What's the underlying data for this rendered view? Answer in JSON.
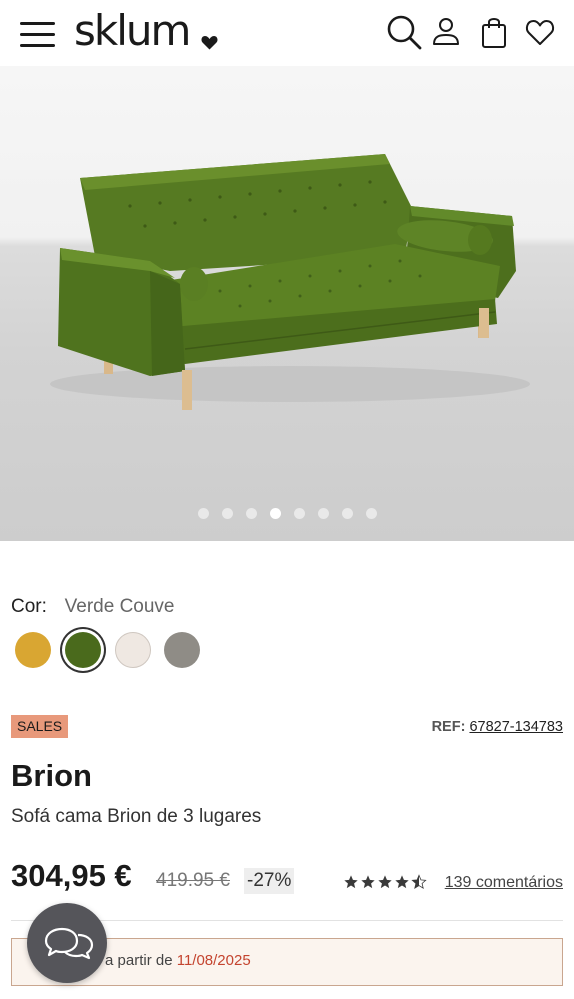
{
  "header": {
    "logo_text": "sklum",
    "menu_icon": "hamburger-icon",
    "icons": [
      "search-icon",
      "user-icon",
      "bag-icon",
      "heart-icon"
    ]
  },
  "gallery": {
    "slide_count": 8,
    "active_index": 3
  },
  "color": {
    "label": "Cor:",
    "selected": "Verde Couve",
    "options": [
      {
        "name": "mustard",
        "hex": "#d9a632"
      },
      {
        "name": "green",
        "hex": "#4a6a1c"
      },
      {
        "name": "cream",
        "hex": "#efe8e2"
      },
      {
        "name": "grey",
        "hex": "#8f8c86"
      }
    ]
  },
  "product": {
    "badge": "SALES",
    "ref_label": "REF:",
    "ref_code": "67827-134783",
    "name": "Brion",
    "description": "Sofá cama Brion de 3 lugares",
    "price": "304,95 €",
    "old_price": "419.95 €",
    "discount": "-27%",
    "rating": 4.5,
    "reviews": "139 comentários"
  },
  "delivery": {
    "text_prefix": "a partir de",
    "date": "11/08/2025"
  },
  "colors": {
    "sales_badge": "#e8997b",
    "delivery_date": "#c4442f",
    "chat_button": "#55555a"
  }
}
